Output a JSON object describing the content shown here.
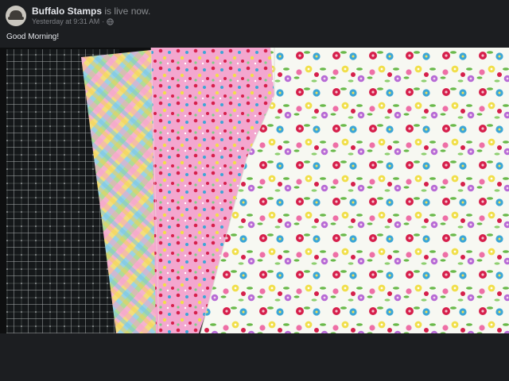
{
  "post": {
    "author": "Buffalo Stamps",
    "status": " is live now.",
    "timestamp": "Yesterday at 9:31 AM",
    "privacy_icon": "globe-icon",
    "message": "Good Morning!"
  },
  "video": {
    "colors": {
      "mat": "#15181a",
      "grid": "#cfd4d4",
      "plaid_base": "#f3f1ea",
      "pink_paper": "#f3a7cf",
      "white_paper": "#f7f8f2",
      "red_flower": "#d61f4b",
      "blue_flower": "#3ba6d6",
      "yellow_flower": "#f1df4a",
      "purple_flower": "#b76ad6",
      "leaf": "#69b94a"
    }
  }
}
